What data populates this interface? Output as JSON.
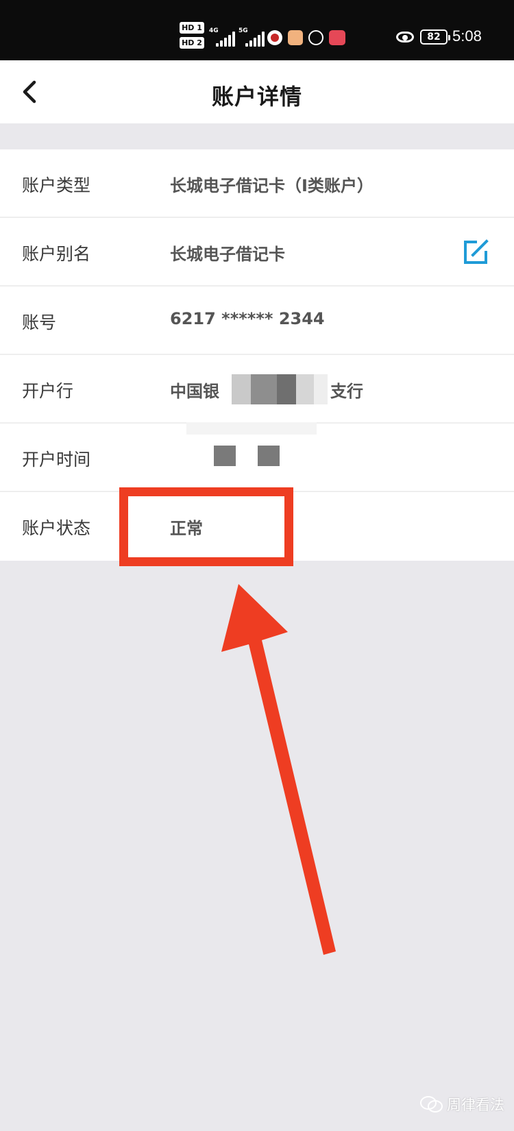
{
  "status_bar": {
    "hd_labels": [
      "HD 1",
      "HD 2"
    ],
    "network_1": "4G",
    "network_2": "5G",
    "battery": "82",
    "time": "5:08"
  },
  "header": {
    "title": "账户详情"
  },
  "details": [
    {
      "label": "账户类型",
      "value": "长城电子借记卡（I类账户）"
    },
    {
      "label": "账户别名",
      "value": "长城电子借记卡"
    },
    {
      "label": "账号",
      "value": "6217 ****** 2344"
    },
    {
      "label": "开户行",
      "value_prefix": "中国银",
      "value_suffix": "支行"
    },
    {
      "label": "开户时间",
      "value": ""
    },
    {
      "label": "账户状态",
      "value": "正常"
    }
  ],
  "colors": {
    "annotation_red": "#ee3d22",
    "edit_icon": "#1f9bd7",
    "background": "#e9e8ec"
  },
  "icons": {
    "back": "chevron-left-icon",
    "edit": "edit-icon"
  },
  "watermark": {
    "text": "周律看法"
  }
}
